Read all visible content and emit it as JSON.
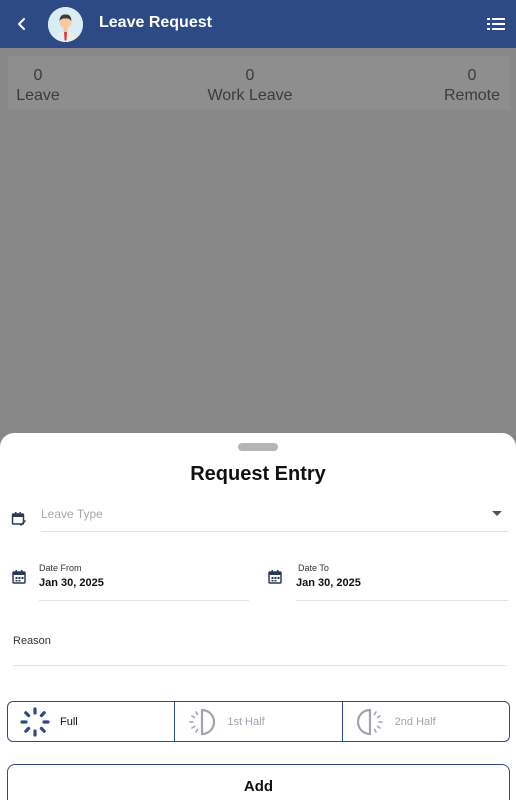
{
  "appbar": {
    "title": "Leave Request",
    "back_icon": "chevron-left-icon",
    "menu_icon": "list-icon",
    "avatar": "user-avatar"
  },
  "summary": [
    {
      "value": "0",
      "label": "Leave"
    },
    {
      "value": "0",
      "label": "Work Leave"
    },
    {
      "value": "0",
      "label": "Remote"
    }
  ],
  "sheet": {
    "title": "Request Entry",
    "leave_type": {
      "placeholder": "Leave Type"
    },
    "date_from": {
      "label": "Date From",
      "value": "Jan 30, 2025"
    },
    "date_to": {
      "label": "Date To",
      "value": "Jan 30, 2025"
    },
    "reason": {
      "label": "Reason"
    },
    "segments": [
      {
        "label": "Full",
        "selected": true,
        "icon": "full-day-icon"
      },
      {
        "label": "1st Half",
        "selected": false,
        "icon": "first-half-icon"
      },
      {
        "label": "2nd Half",
        "selected": false,
        "icon": "second-half-icon"
      }
    ],
    "add_label": "Add"
  },
  "colors": {
    "primary": "#2d4a84",
    "backdrop": "#888888"
  }
}
